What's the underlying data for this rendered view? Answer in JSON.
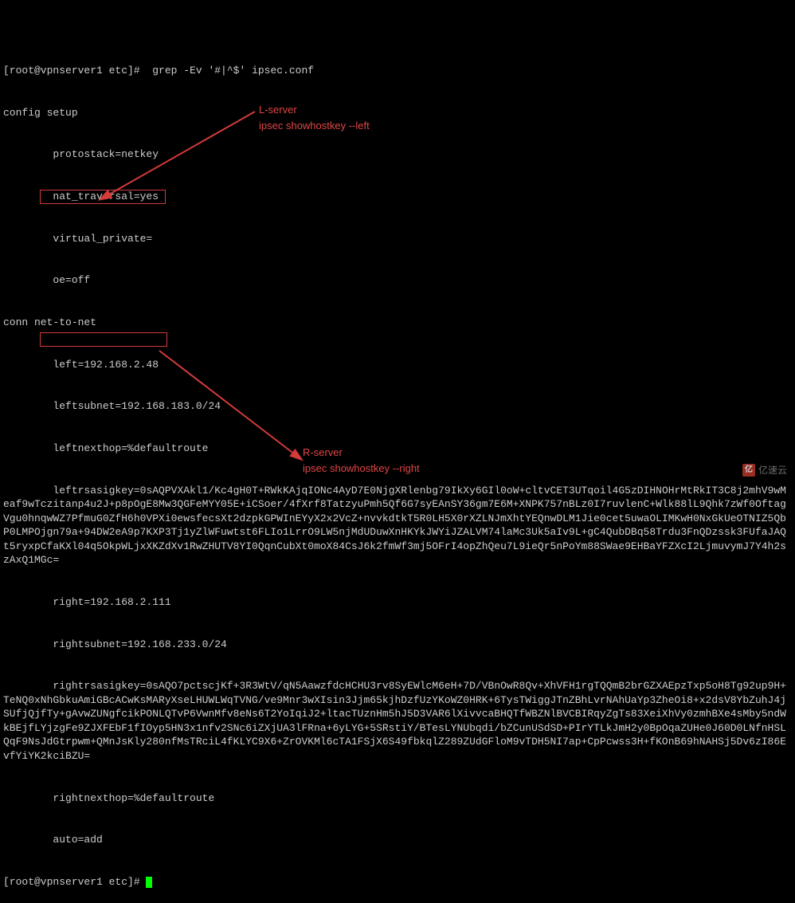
{
  "prompt_line0": "[root@vpnserver1 etc]#  grep -Ev '#|^$' ipsec.conf",
  "cfg": {
    "setup": "config setup",
    "protostack": "        protostack=netkey",
    "nat_traversal": "        nat_traversal=yes",
    "virtual_private": "        virtual_private=",
    "oe": "        oe=off",
    "conn": "conn net-to-net",
    "left": "        left=192.168.2.48",
    "leftsubnet": "        leftsubnet=192.168.183.0/24",
    "leftnexthop": "        leftnexthop=%defaultroute",
    "leftkey_label": "        leftrsasigkey=",
    "leftkey_value": "0sAQPVXAkl1/Kc4gH0T+RWkKAjqIONc4AyD7E0NjgXRlenbg79IkXy6GIl0oW+cltvCET3UTqoil4G5zDIHNOHrMtRkIT3C8j2mhV9wMeaf9wTczitanp4u2J+p8pOgE8Mw3QGFeMYY05E+iCSoer/4fXrf8TatzyuPmh5Qf6G7syEAnSY36gm7E6M+XNPK757nBLz0I7ruvlenC+Wlk88lL9Qhk7zWf0OftagVgu0hnqwWZ7PfmuG0ZfH6h0VPXi0ewsfecsXt2dzpkGPWInEYyX2x2VcZ+nvvkdtkT5R0LH5X0rXZLNJmXhtYEQnwDLM1Jie0cet5uwaOLIMKwH0NxGkUeOTNIZ5QbP0LMPOjgn79a+94DW2eA9p7KXP3Tj1yZlWFuwtst6FLIo1LrrO9LW5njMdUDuwXnHKYkJWYiJZALVM74laMc3Uk5aIv9L+gC4QubDBq58Trdu3FnQDzssk3FUfaJAQt5ryxpCfaKXl04q5OkpWLjxXKZdXv1RwZHUTV8YI0QqnCubXt0moX84CsJ6k2fmWf3mj5OFrI4opZhQeu7L9ieQr5nPoYm88SWae9EHBaYFZXcI2LjmuvymJ7Y4h2szAxQ1MGc=",
    "right": "        right=192.168.2.111",
    "rightsubnet": "        rightsubnet=192.168.233.0/24",
    "rightkey_label": "        rightrsasigkey=",
    "rightkey_value": "0sAQO7pctscjKf+3R3WtV/qN5AawzfdcHCHU3rv8SyEWlcM6eH+7D/VBnOwR8Qv+XhVFH1rgTQQmB2brGZXAEpzTxp5oH8Tg92up9H+TeNQ0xNhGbkuAmiGBcACwKsMARyXseLHUWLWqTVNG/ve9Mnr3wXIsin3Jjm65kjhDzfUzYKoWZ0HRK+6TysTWiggJTnZBhLvrNAhUaYp3ZheOi8+x2dsV8YbZuhJ4jSUfjQjfTy+gAvwZUNgfcikPONLQTvP6VwnMfv8eNs6T2YoIqiJ2+ltacTUznHm5hJ5D3VAR6lXivvcaBHQTfWBZNlBVCBIRqyZgTs83XeiXhVy0zmhBXe4sMby5ndWkBEjfLYjzgFe9ZJXFEbF1fIOyp5HN3x1nfv2SNc6iZXjUA3lFRna+6yLYG+5SRstiY/BTesLYNUbqdi/bZCunUSdSD+PIrYTLkJmH2y0BpOqaZUHe0J60D0LNfnHSLQqF9NsJdGtrpwm+QMnJsKly280nfMsTRciL4fKLYC9X6+ZrOVKMl6cTA1FSjX6S49fbkqlZ289ZUdGFloM9vTDH5NI7ap+CpPcwss3H+fKOnB69hNAHSj5Dv6zI86EvfYiYK2kciBZU=",
    "rightnexthop": "        rightnexthop=%defaultroute",
    "auto": "        auto=add"
  },
  "prompt_line1": "[root@vpnserver1 etc]# ",
  "annotation_left": {
    "title": "L-server",
    "cmd": "ipsec showhostkey --left"
  },
  "annotation_right": {
    "title": "R-server",
    "cmd": "ipsec showhostkey --right"
  },
  "watermark": "亿速云"
}
